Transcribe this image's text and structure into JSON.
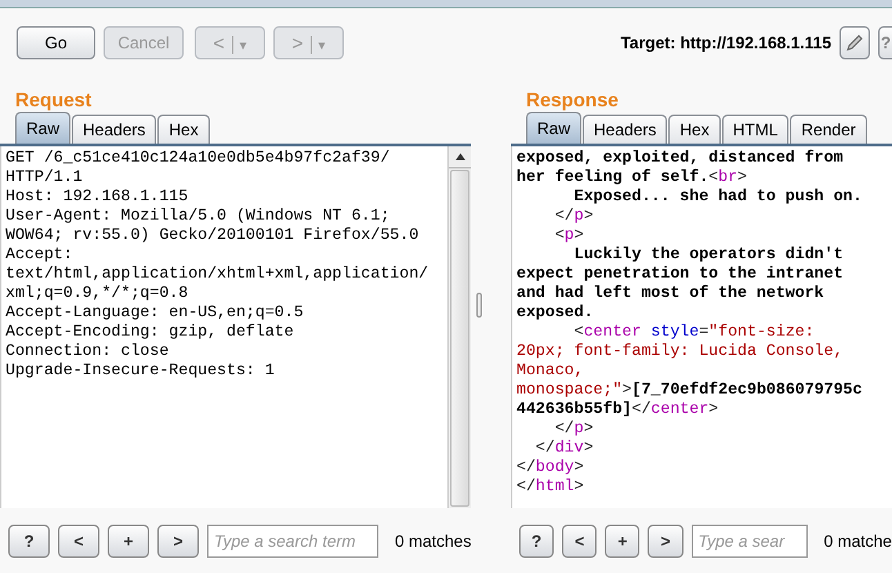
{
  "toolbar": {
    "buttons": [
      {
        "kind": "plain",
        "label": "Go",
        "disabled": false
      },
      {
        "kind": "plain",
        "label": "Cancel",
        "disabled": true
      },
      {
        "kind": "split",
        "label": "<",
        "menu": "▾",
        "disabled": true
      },
      {
        "kind": "split",
        "label": ">",
        "menu": "▾",
        "disabled": true
      }
    ],
    "target": "Target: http://192.168.1.115",
    "help": "?"
  },
  "request": {
    "heading": "Request",
    "tabs": [
      {
        "label": "Raw",
        "selected": true
      },
      {
        "label": "Headers",
        "selected": false
      },
      {
        "label": "Hex",
        "selected": false
      }
    ],
    "lines": [
      "GET /6_c51ce410c124a10e0db5e4b97fc2af39/",
      "HTTP/1.1",
      "Host: 192.168.1.115",
      "User-Agent: Mozilla/5.0 (Windows NT 6.1;",
      "WOW64; rv:55.0) Gecko/20100101 Firefox/55.0",
      "Accept:",
      "text/html,application/xhtml+xml,application/",
      "xml;q=0.9,*/*;q=0.8",
      "Accept-Language: en-US,en;q=0.5",
      "Accept-Encoding: gzip, deflate",
      "Connection: close",
      "Upgrade-Insecure-Requests: 1"
    ],
    "search": {
      "buttons": [
        "?",
        "<",
        "+",
        ">"
      ],
      "placeholder": "Type a search term",
      "matches": "0 matches"
    }
  },
  "response": {
    "heading": "Response",
    "tabs": [
      {
        "label": "Raw",
        "selected": true
      },
      {
        "label": "Headers",
        "selected": false
      },
      {
        "label": "Hex",
        "selected": false
      },
      {
        "label": "HTML",
        "selected": false
      },
      {
        "label": "Render",
        "selected": false
      }
    ],
    "lines": [
      [
        {
          "kind": "text",
          "text": "exposed, exploited, distanced from"
        }
      ],
      [
        {
          "kind": "text",
          "text": "her feeling of self."
        },
        {
          "kind": "punct",
          "text": "<"
        },
        {
          "kind": "tag",
          "text": "br"
        },
        {
          "kind": "punct",
          "text": ">"
        }
      ],
      [
        {
          "kind": "text",
          "text": "      Exposed... she had to push on."
        }
      ],
      [
        {
          "kind": "punct",
          "text": "    </"
        },
        {
          "kind": "tag",
          "text": "p"
        },
        {
          "kind": "punct",
          "text": ">"
        }
      ],
      [
        {
          "kind": "punct",
          "text": "    <"
        },
        {
          "kind": "tag",
          "text": "p"
        },
        {
          "kind": "punct",
          "text": ">"
        }
      ],
      [
        {
          "kind": "text",
          "text": "      Luckily the operators didn't"
        }
      ],
      [
        {
          "kind": "text",
          "text": "expect penetration to the intranet"
        }
      ],
      [
        {
          "kind": "text",
          "text": "and had left most of the network"
        }
      ],
      [
        {
          "kind": "text",
          "text": "exposed."
        }
      ],
      [
        {
          "kind": "punct",
          "text": "      <"
        },
        {
          "kind": "tag",
          "text": "center"
        },
        {
          "kind": "attr",
          "text": "style"
        },
        {
          "kind": "punct",
          "text": "="
        },
        {
          "kind": "value",
          "text": "\"font-size:"
        }
      ],
      [
        {
          "kind": "value",
          "text": "20px; font-family: Lucida Console,"
        }
      ],
      [
        {
          "kind": "value",
          "text": "Monaco,"
        }
      ],
      [
        {
          "kind": "value",
          "text": "monospace;\""
        },
        {
          "kind": "punct",
          "text": ">"
        },
        {
          "kind": "text",
          "text": "[7_70efdf2ec9b086079795c"
        }
      ],
      [
        {
          "kind": "text",
          "text": "442636b55fb]"
        },
        {
          "kind": "punct",
          "text": "</"
        },
        {
          "kind": "tag",
          "text": "center"
        },
        {
          "kind": "punct",
          "text": ">"
        }
      ],
      [
        {
          "kind": "punct",
          "text": "    </"
        },
        {
          "kind": "tag",
          "text": "p"
        },
        {
          "kind": "punct",
          "text": ">"
        }
      ],
      [
        {
          "kind": "punct",
          "text": "  </"
        },
        {
          "kind": "tag",
          "text": "div"
        },
        {
          "kind": "punct",
          "text": ">"
        }
      ],
      [
        {
          "kind": "punct",
          "text": "</"
        },
        {
          "kind": "tag",
          "text": "body"
        },
        {
          "kind": "punct",
          "text": ">"
        }
      ],
      [
        {
          "kind": "punct",
          "text": "</"
        },
        {
          "kind": "tag",
          "text": "html"
        },
        {
          "kind": "punct",
          "text": ">"
        }
      ]
    ],
    "search": {
      "buttons": [
        "?",
        "<",
        "+",
        ">"
      ],
      "placeholder": "Type a sear",
      "matches": "0 matche"
    }
  }
}
